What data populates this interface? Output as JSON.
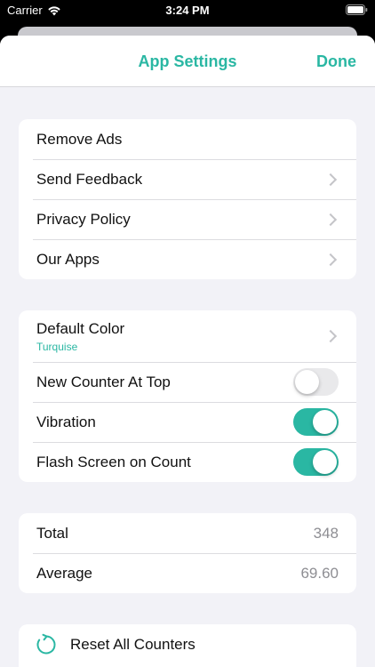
{
  "status_bar": {
    "carrier": "Carrier",
    "time": "3:24 PM",
    "wifi_icon": "wifi-icon",
    "battery_icon": "battery-icon"
  },
  "navbar": {
    "title": "App Settings",
    "done_label": "Done"
  },
  "groups": {
    "general": {
      "remove_ads": "Remove Ads",
      "send_feedback": "Send Feedback",
      "privacy_policy": "Privacy Policy",
      "our_apps": "Our Apps"
    },
    "preferences": {
      "default_color_label": "Default Color",
      "default_color_value": "Turquise",
      "new_counter_at_top": "New Counter At Top",
      "new_counter_at_top_on": false,
      "vibration": "Vibration",
      "vibration_on": true,
      "flash_screen": "Flash Screen on Count",
      "flash_screen_on": true
    },
    "stats": {
      "total_label": "Total",
      "total_value": "348",
      "average_label": "Average",
      "average_value": "69.60"
    },
    "actions": {
      "reset_all": "Reset All Counters",
      "reset_icon": "reset-icon"
    }
  },
  "colors": {
    "accent": "#2ab7a3",
    "background": "#f2f2f7",
    "secondary_text": "#8e8e93"
  }
}
